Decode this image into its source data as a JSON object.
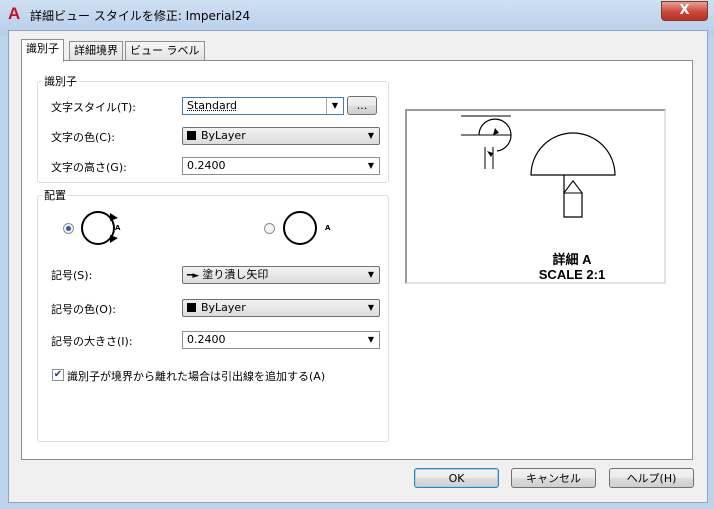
{
  "window": {
    "title": "詳細ビュー スタイルを修正: Imperial24",
    "app_icon": "A",
    "close_glyph": "X"
  },
  "tabs": [
    {
      "label": "識別子",
      "active": true
    },
    {
      "label": "詳細境界",
      "active": false
    },
    {
      "label": "ビュー ラベル",
      "active": false
    }
  ],
  "identifier_group": {
    "title": "識別子",
    "text_style_label": "文字スタイル(T):",
    "text_style_value": "Standard",
    "browse_label": "...",
    "text_color_label": "文字の色(C):",
    "text_color_value": "ByLayer",
    "text_height_label": "文字の高さ(G):",
    "text_height_value": "0.2400"
  },
  "placement_group": {
    "title": "配置",
    "option1_letter": "A",
    "option2_letter": "A",
    "option1_selected": true,
    "symbol_label": "記号(S):",
    "symbol_value": "塗り潰し矢印",
    "symbol_color_label": "記号の色(O):",
    "symbol_color_value": "ByLayer",
    "symbol_size_label": "記号の大きさ(I):",
    "symbol_size_value": "0.2400",
    "leader_checkbox_label": "識別子が境界から離れた場合は引出線を追加する(A)",
    "leader_checked": true
  },
  "preview": {
    "line1": "詳細 A",
    "line2": "SCALE 2:1"
  },
  "footer": {
    "ok": "OK",
    "cancel": "キャンセル",
    "help": "ヘルプ(H)"
  },
  "colors": {
    "title_bg": "#bcd3ec",
    "close_red": "#c9473a",
    "radio_dot": "#2a5fa8"
  }
}
